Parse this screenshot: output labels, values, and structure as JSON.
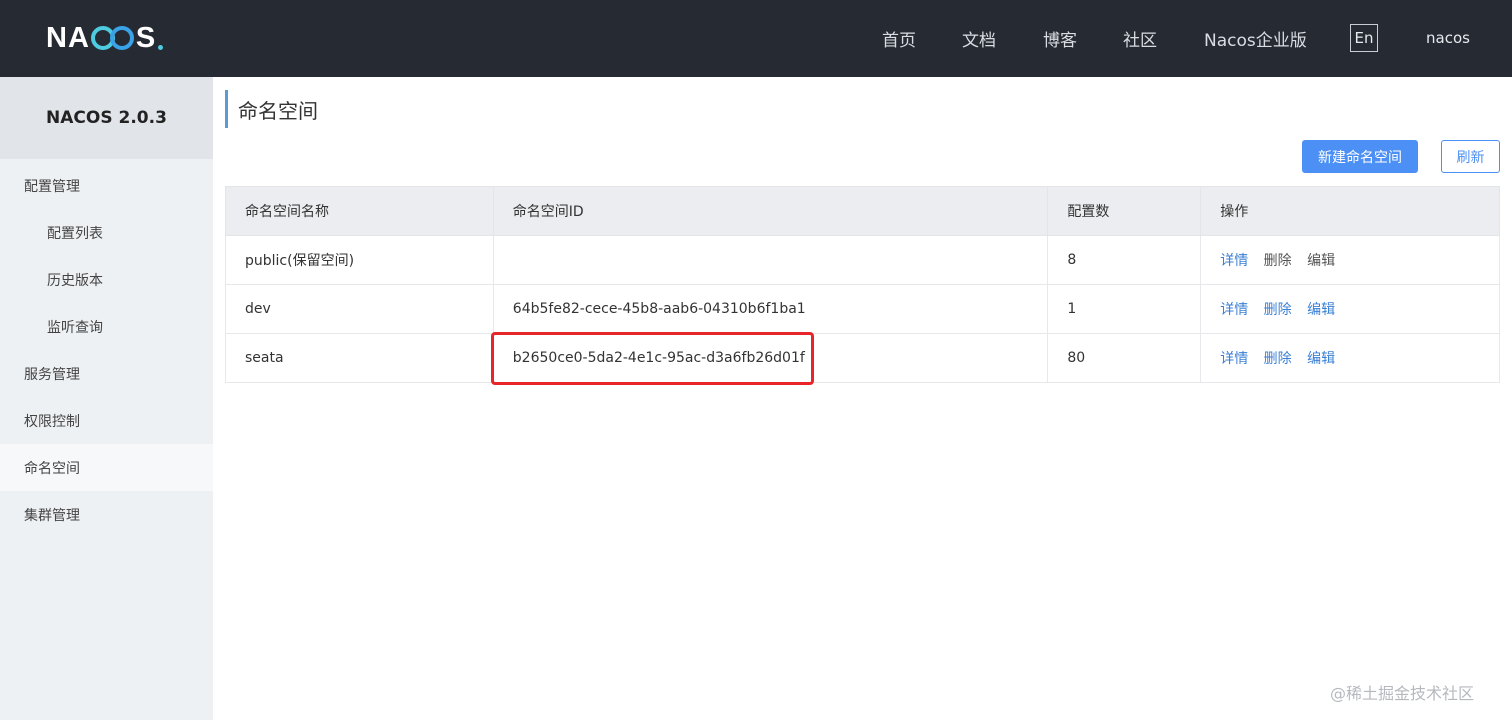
{
  "header": {
    "logo_text": "NACOS.",
    "nav": [
      "首页",
      "文档",
      "博客",
      "社区",
      "Nacos企业版"
    ],
    "lang": "En",
    "user": "nacos"
  },
  "sidebar": {
    "title": "NACOS 2.0.3",
    "items": [
      {
        "label": "配置管理"
      },
      {
        "label": "配置列表"
      },
      {
        "label": "历史版本"
      },
      {
        "label": "监听查询"
      },
      {
        "label": "服务管理"
      },
      {
        "label": "权限控制"
      },
      {
        "label": "命名空间"
      },
      {
        "label": "集群管理"
      }
    ],
    "active": "命名空间"
  },
  "main": {
    "title": "命名空间",
    "create_button": "新建命名空间",
    "refresh_button": "刷新",
    "table": {
      "headers": [
        "命名空间名称",
        "命名空间ID",
        "配置数",
        "操作"
      ],
      "rows": [
        {
          "name": "public(保留空间)",
          "id": "",
          "count": "8",
          "ops": [
            "详情",
            "删除",
            "编辑"
          ]
        },
        {
          "name": "dev",
          "id": "64b5fe82-cece-45b8-aab6-04310b6f1ba1",
          "count": "1",
          "ops": [
            "详情",
            "删除",
            "编辑"
          ]
        },
        {
          "name": "seata",
          "id": "b2650ce0-5da2-4e1c-95ac-d3a6fb26d01f",
          "count": "80",
          "ops": [
            "详情",
            "删除",
            "编辑"
          ]
        }
      ]
    },
    "highlight_color": "#e8262a"
  },
  "watermark": "@稀土掘金技术社区"
}
